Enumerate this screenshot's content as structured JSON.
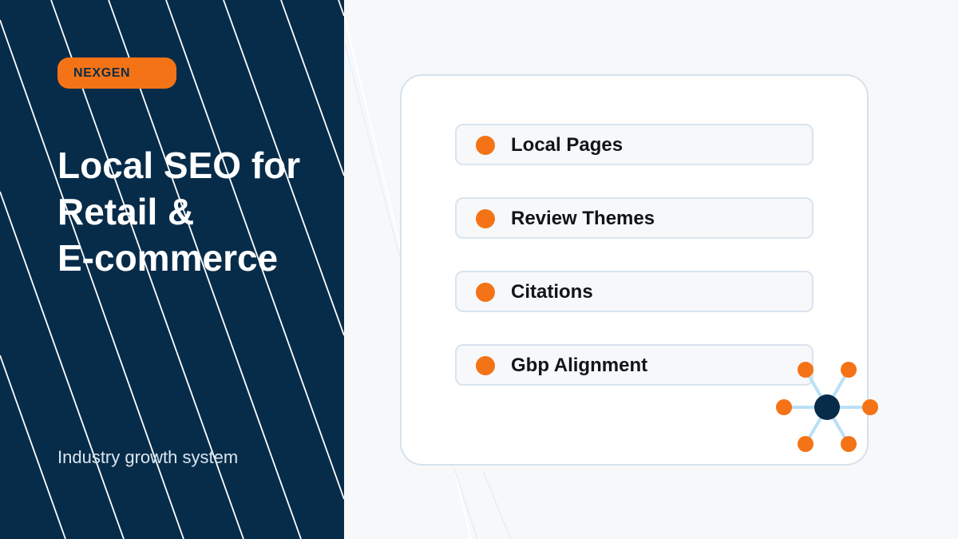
{
  "brand": {
    "badge": "NEXGEN"
  },
  "hero": {
    "title_lines": [
      "Local SEO for",
      "Retail &",
      "E-commerce"
    ],
    "subtitle": "Industry growth system"
  },
  "card": {
    "items": [
      {
        "label": "Local Pages"
      },
      {
        "label": "Review Themes"
      },
      {
        "label": "Citations"
      },
      {
        "label": "Gbp Alignment"
      }
    ]
  },
  "colors": {
    "navy": "#072c4a",
    "accent": "#f47316",
    "background": "#f6f8fa",
    "connector": "#b9e0f6"
  },
  "icons": {
    "network": "hub-network-icon"
  }
}
